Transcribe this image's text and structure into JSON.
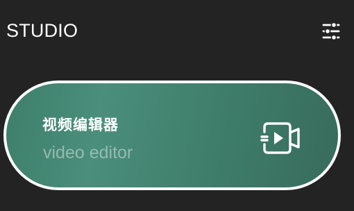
{
  "app_bar": {
    "title": "STUDIO",
    "settings_icon": "sliders-icon"
  },
  "feature_card": {
    "title": "视频编辑器",
    "subtitle": "video editor",
    "icon": "video-camera-icon",
    "colors": {
      "gradient_start": "#3d7f6b",
      "gradient_mid": "#4a8e7b",
      "gradient_end": "#386b5d",
      "border": "#ffffff"
    }
  },
  "colors": {
    "background": "#232323",
    "text": "#ffffff"
  }
}
